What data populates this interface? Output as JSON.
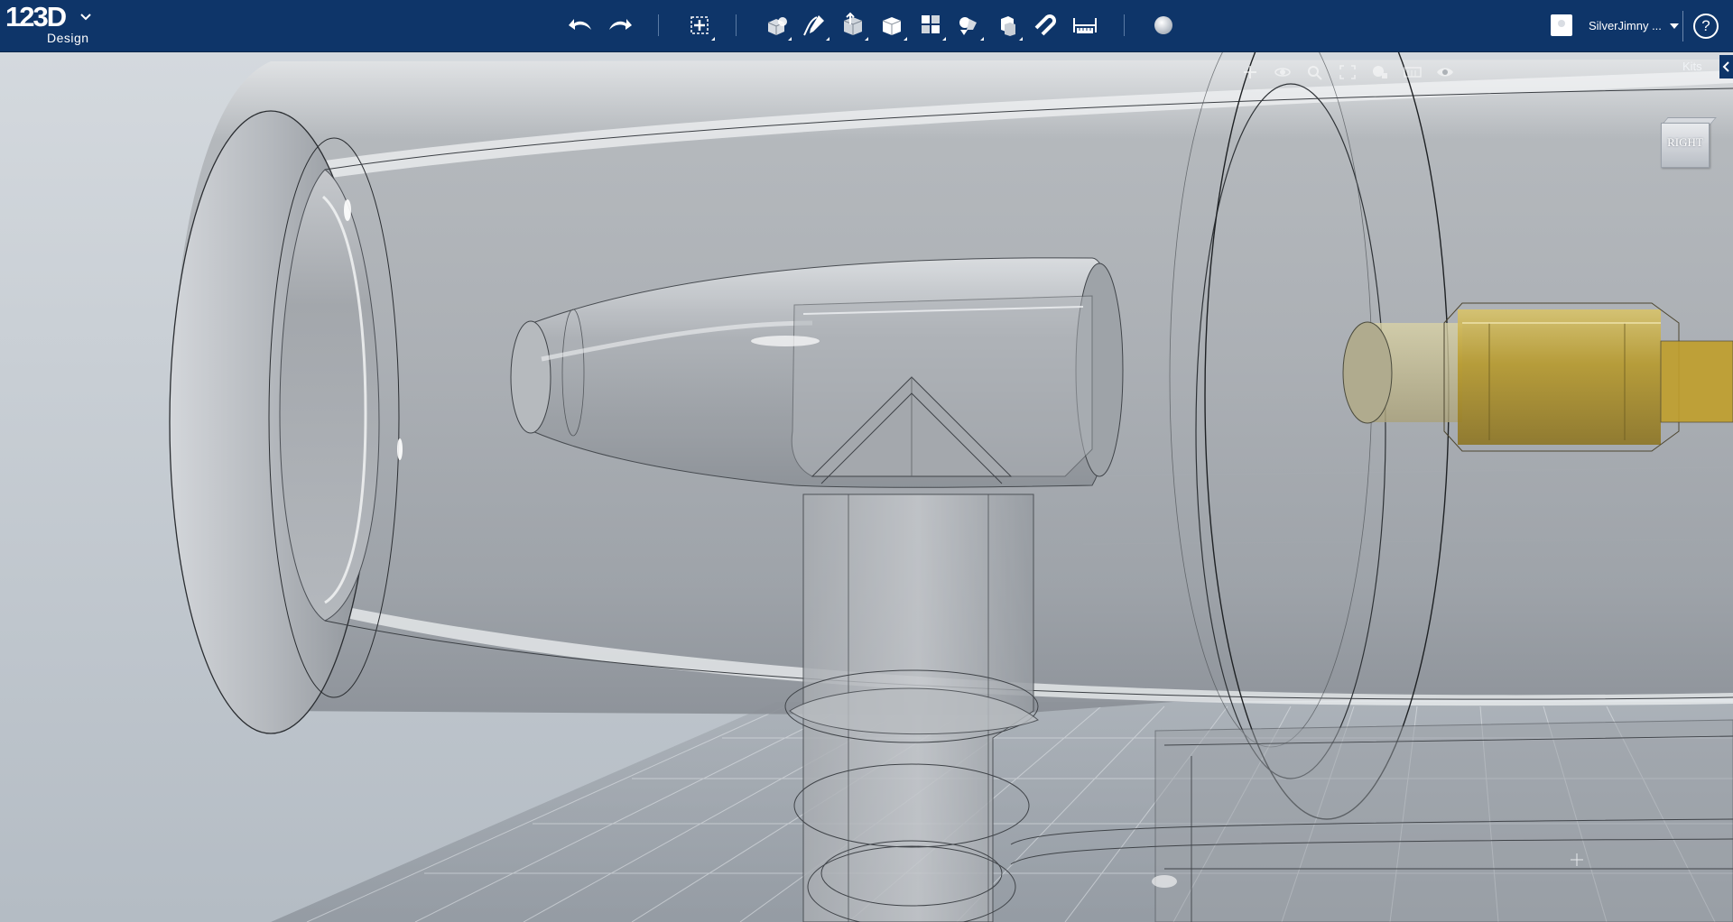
{
  "app": {
    "logo_text": "123D",
    "logo_sub": "Design"
  },
  "toolbar": {
    "items": [
      {
        "id": "undo",
        "icon": "undo-arrow-icon"
      },
      {
        "id": "redo",
        "icon": "redo-arrow-icon"
      },
      {
        "id": "transform",
        "icon": "transform-icon"
      },
      {
        "id": "primitives",
        "icon": "primitives-box-icon"
      },
      {
        "id": "sketch",
        "icon": "sketch-pencil-icon"
      },
      {
        "id": "construct",
        "icon": "construct-icon"
      },
      {
        "id": "modify",
        "icon": "modify-cube-icon"
      },
      {
        "id": "pattern",
        "icon": "pattern-grid-icon"
      },
      {
        "id": "grouping",
        "icon": "grouping-icon"
      },
      {
        "id": "combine",
        "icon": "combine-icon"
      },
      {
        "id": "snap",
        "icon": "snap-magnet-icon"
      },
      {
        "id": "measure",
        "icon": "measure-ruler-icon"
      },
      {
        "id": "material",
        "icon": "material-sphere-icon"
      }
    ]
  },
  "user": {
    "name": "SilverJimny ..."
  },
  "help": {
    "label": "?"
  },
  "viewport": {
    "kits_label": "Kits",
    "viewcube_label": "RIGHT",
    "nav_tools": [
      "pan-icon",
      "orbit-icon",
      "zoom-icon",
      "fit-icon",
      "view-options-icon",
      "units-icon",
      "visibility-eye-icon"
    ]
  },
  "colors": {
    "topbar": "#0e3569",
    "model_gray": "#9a9ea4",
    "accent_yellow": "#c7a42a"
  }
}
